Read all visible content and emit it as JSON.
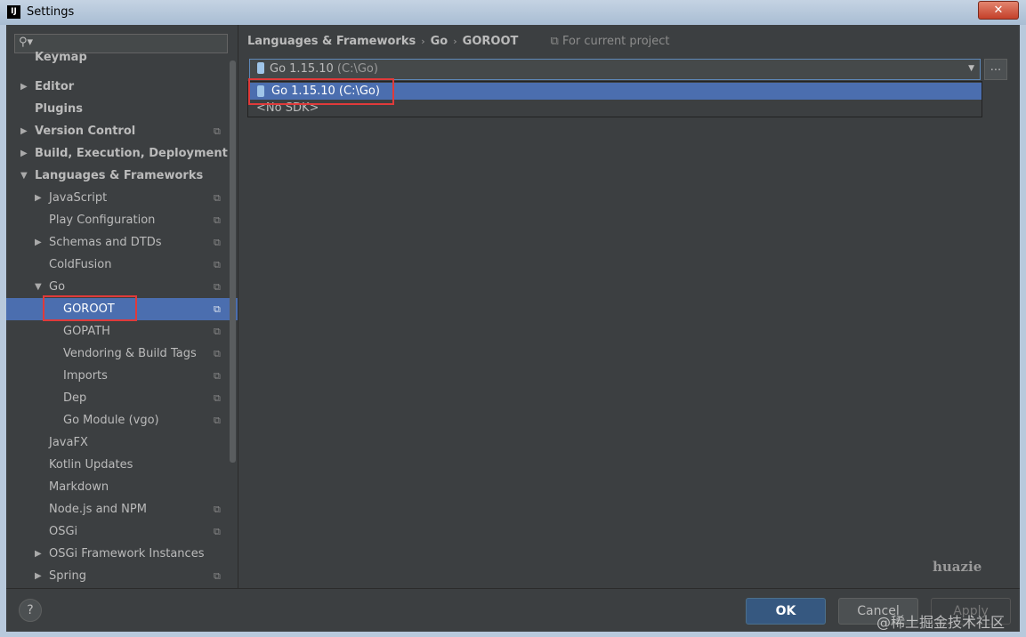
{
  "window": {
    "title": "Settings",
    "app_icon": "IJ",
    "close": "✕"
  },
  "search": {
    "value": ""
  },
  "tree": [
    {
      "label": "Keymap",
      "bold": true
    },
    {
      "label": "Editor",
      "bold": true,
      "arrow": "right"
    },
    {
      "label": "Plugins",
      "bold": true
    },
    {
      "label": "Version Control",
      "bold": true,
      "arrow": "right",
      "copy": true
    },
    {
      "label": "Build, Execution, Deployment",
      "bold": true,
      "arrow": "right"
    },
    {
      "label": "Languages & Frameworks",
      "bold": true,
      "arrow": "down"
    },
    {
      "label": "JavaScript",
      "arrow": "right",
      "copy": true
    },
    {
      "label": "Play Configuration",
      "copy": true
    },
    {
      "label": "Schemas and DTDs",
      "arrow": "right",
      "copy": true
    },
    {
      "label": "ColdFusion",
      "copy": true
    },
    {
      "label": "Go",
      "arrow": "down",
      "copy": true
    },
    {
      "label": "GOROOT",
      "copy": true,
      "selected": true
    },
    {
      "label": "GOPATH",
      "copy": true
    },
    {
      "label": "Vendoring & Build Tags",
      "copy": true
    },
    {
      "label": "Imports",
      "copy": true
    },
    {
      "label": "Dep",
      "copy": true
    },
    {
      "label": "Go Module (vgo)",
      "copy": true
    },
    {
      "label": "JavaFX"
    },
    {
      "label": "Kotlin Updates"
    },
    {
      "label": "Markdown"
    },
    {
      "label": "Node.js and NPM",
      "copy": true
    },
    {
      "label": "OSGi",
      "copy": true
    },
    {
      "label": "OSGi Framework Instances",
      "arrow": "right"
    },
    {
      "label": "Spring",
      "arrow": "right",
      "copy": true
    }
  ],
  "breadcrumb": {
    "items": [
      "Languages & Frameworks",
      "Go",
      "GOROOT"
    ],
    "scope": "For current project"
  },
  "sdk": {
    "selected": "Go 1.15.10",
    "selected_path": "(C:\\Go)",
    "options": [
      {
        "name": "Go 1.15.10",
        "path": "(C:\\Go)"
      },
      {
        "name": "<No SDK>",
        "path": ""
      }
    ],
    "browse": "..."
  },
  "footer": {
    "help": "?",
    "ok": "OK",
    "cancel": "Cancel",
    "apply": "Apply"
  },
  "watermark": "huazie",
  "juejin_mark": "@稀土掘金技术社区",
  "colors": {
    "selection": "#4b6eaf",
    "background": "#3c3f41",
    "highlight": "#e03a3a"
  }
}
